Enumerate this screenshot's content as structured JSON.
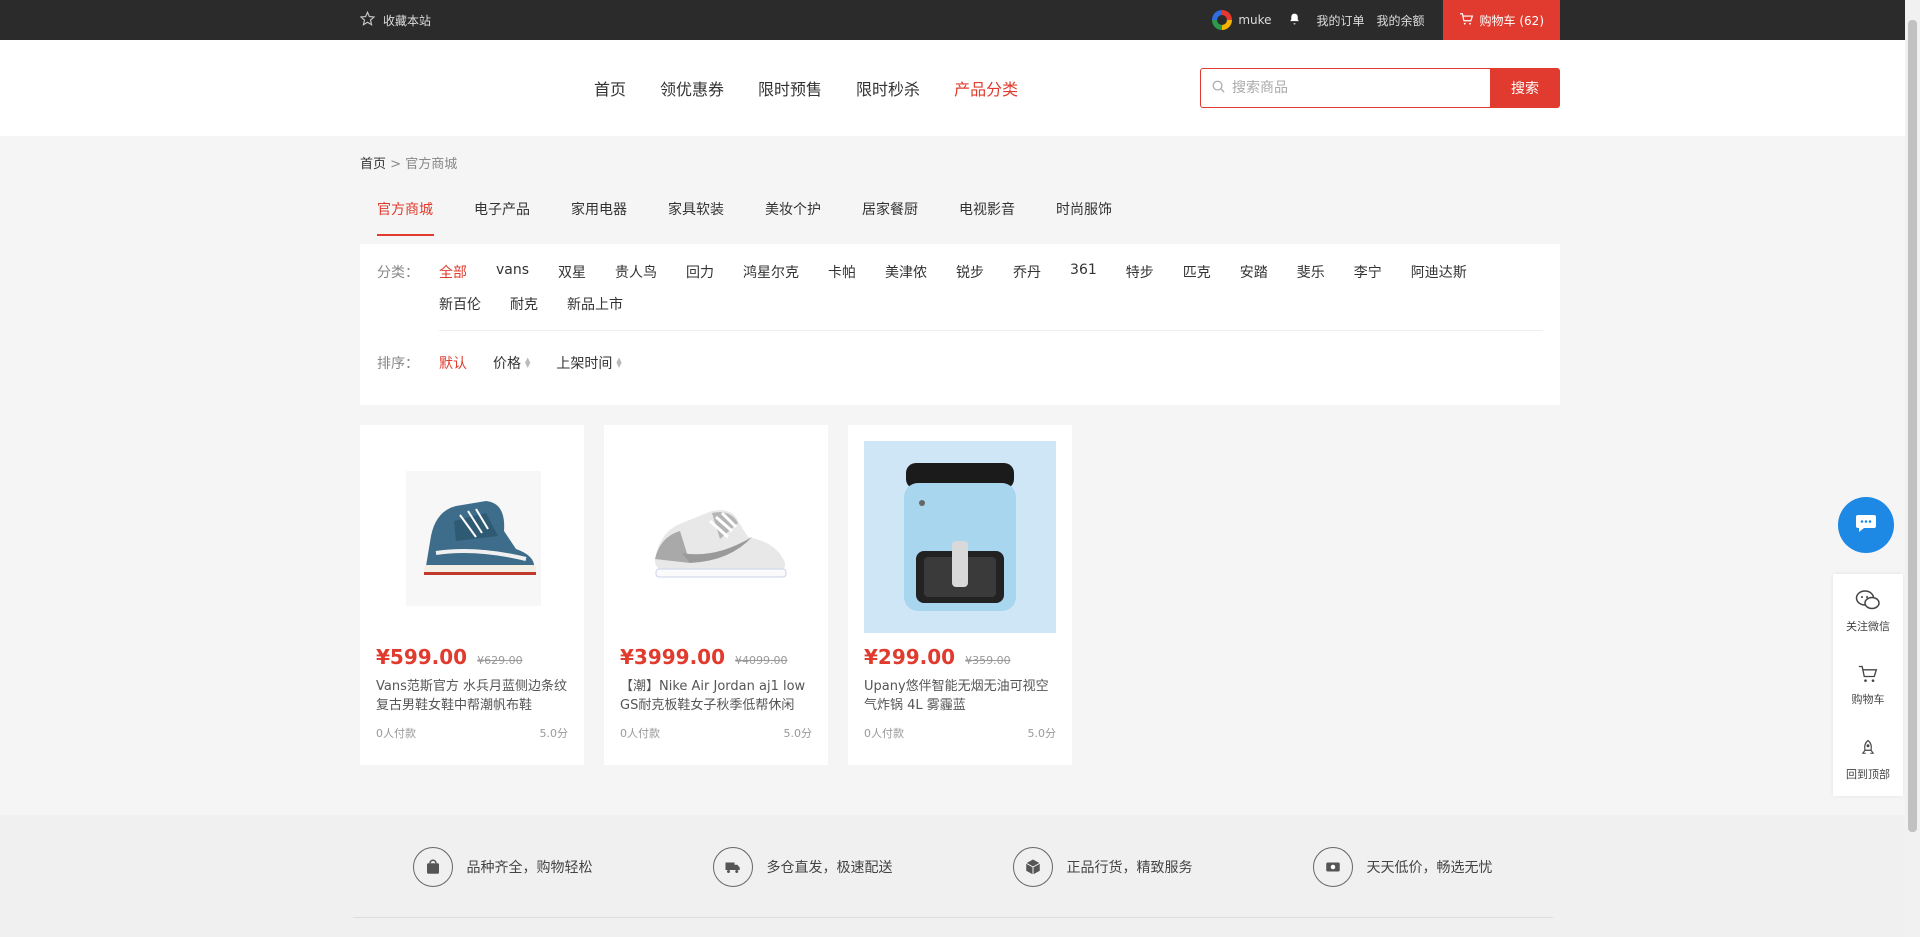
{
  "topbar": {
    "favorite": "收藏本站",
    "username": "muke",
    "orders": "我的订单",
    "balance": "我的余额",
    "cart": "购物车 (62)"
  },
  "nav": {
    "items": [
      {
        "label": "首页",
        "active": false
      },
      {
        "label": "领优惠券",
        "active": false
      },
      {
        "label": "限时预售",
        "active": false
      },
      {
        "label": "限时秒杀",
        "active": false
      },
      {
        "label": "产品分类",
        "active": true
      }
    ]
  },
  "search": {
    "placeholder": "搜索商品",
    "button": "搜索"
  },
  "breadcrumb": {
    "home": "首页",
    "sep": ">",
    "current": "官方商城"
  },
  "categories": [
    {
      "label": "官方商城",
      "active": true
    },
    {
      "label": "电子产品",
      "active": false
    },
    {
      "label": "家用电器",
      "active": false
    },
    {
      "label": "家具软装",
      "active": false
    },
    {
      "label": "美妆个护",
      "active": false
    },
    {
      "label": "居家餐厨",
      "active": false
    },
    {
      "label": "电视影音",
      "active": false
    },
    {
      "label": "时尚服饰",
      "active": false
    }
  ],
  "filter": {
    "label": "分类：",
    "options": [
      "全部",
      "vans",
      "双星",
      "贵人鸟",
      "回力",
      "鸿星尔克",
      "卡帕",
      "美津侬",
      "锐步",
      "乔丹",
      "361",
      "特步",
      "匹克",
      "安踏",
      "斐乐",
      "李宁",
      "阿迪达斯",
      "新百伦",
      "耐克",
      "新品上市"
    ],
    "active_index": 0
  },
  "sort": {
    "label": "排序：",
    "options": [
      "默认",
      "价格",
      "上架时间"
    ]
  },
  "products": [
    {
      "price": "¥599.00",
      "original": "¥629.00",
      "title": "Vans范斯官方 水兵月蓝侧边条纹复古男鞋女鞋中帮潮帆布鞋",
      "sales": "0人付款",
      "rating": "5.0分",
      "image": "vans-sneaker"
    },
    {
      "price": "¥3999.00",
      "original": "¥4099.00",
      "title": "【潮】Nike Air Jordan aj1 low GS耐克板鞋女子秋季低帮休闲",
      "sales": "0人付款",
      "rating": "5.0分",
      "image": "nike-sneaker"
    },
    {
      "price": "¥299.00",
      "original": "¥359.00",
      "title": "Upany悠伴智能无烟无油可视空气炸锅 4L 雾霾蓝",
      "sales": "0人付款",
      "rating": "5.0分",
      "image": "air-fryer"
    }
  ],
  "footer": {
    "items": [
      {
        "label": "品种齐全，购物轻松",
        "icon": "bag-icon"
      },
      {
        "label": "多仓直发，极速配送",
        "icon": "truck-icon"
      },
      {
        "label": "正品行货，精致服务",
        "icon": "box-icon"
      },
      {
        "label": "天天低价，畅选无忧",
        "icon": "tag-icon"
      }
    ]
  },
  "sidebar": {
    "wechat": "关注微信",
    "cart": "购物车",
    "top": "回到顶部"
  },
  "colors": {
    "accent": "#e03b2e",
    "topbar": "#2b2b2b",
    "chat": "#1e88e5"
  }
}
